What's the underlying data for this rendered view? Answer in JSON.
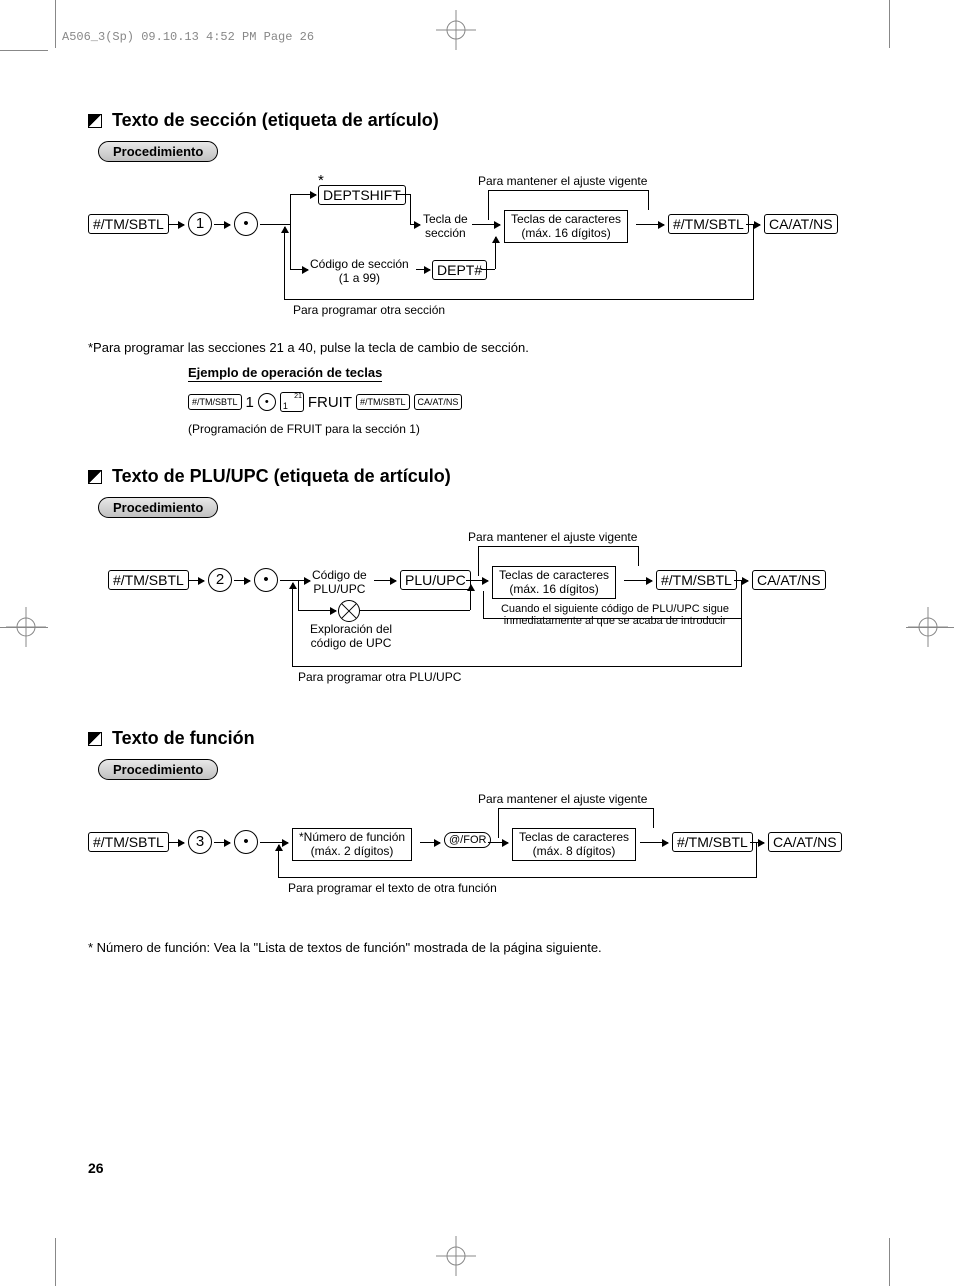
{
  "header": "A506_3(Sp)  09.10.13 4:52 PM  Page 26",
  "pageNumber": "26",
  "sec1": {
    "heading": "Texto de sección (etiqueta de artículo)",
    "proc": "Procedimiento",
    "preserve": "Para mantener el ajuste vigente",
    "k1": "#/TM/SBTL",
    "k2": "1",
    "k3": "•",
    "deptshift": "DEPTSHIFT",
    "asterisk": "*",
    "teclaDe": "Tecla de\nsección",
    "chars": "Teclas de caracteres\n(máx. 16 dígitos)",
    "k4": "#/TM/SBTL",
    "k5": "CA/AT/NS",
    "codSec": "Código de sección\n(1 a 99)",
    "dept": "DEPT#",
    "otraSec": "Para programar otra sección",
    "footnote": "*Para programar las secciones 21 a 40, pulse la tecla de cambio de sección.",
    "exTitle": "Ejemplo de operación de teclas",
    "ex_k1": "#/TM/SBTL",
    "ex_1": "1",
    "ex_dot": "•",
    "ex_sq_main": "1",
    "ex_sq_sup": "21",
    "ex_fruit": "FRUIT",
    "ex_k2": "#/TM/SBTL",
    "ex_k3": "CA/AT/NS",
    "exNote": "(Programación de FRUIT para la sección 1)"
  },
  "sec2": {
    "heading": "Texto de PLU/UPC (etiqueta de artículo)",
    "proc": "Procedimiento",
    "preserve": "Para mantener el ajuste vigente",
    "k1": "#/TM/SBTL",
    "k2": "2",
    "k3": "•",
    "codPlu": "Código de\nPLU/UPC",
    "pluupc": "PLU/UPC",
    "chars": "Teclas de caracteres\n(máx. 16 dígitos)",
    "k4": "#/TM/SBTL",
    "k5": "CA/AT/NS",
    "scan": "Exploración del\ncódigo de UPC",
    "cuando": "Cuando el siguiente código de PLU/UPC sigue\ninmediatamente al que se acaba de introducir",
    "otra": "Para programar otra PLU/UPC"
  },
  "sec3": {
    "heading": "Texto de función",
    "proc": "Procedimiento",
    "preserve": "Para mantener el ajuste vigente",
    "k1": "#/TM/SBTL",
    "k2": "3",
    "k3": "•",
    "numFunc": "*Número de función\n(máx. 2 dígitos)",
    "atfor": "@/FOR",
    "chars": "Teclas de caracteres\n(máx. 8 dígitos)",
    "k4": "#/TM/SBTL",
    "k5": "CA/AT/NS",
    "otra": "Para programar el texto de otra función",
    "footnote": "* Número de función: Vea la \"Lista de textos de función\" mostrada de la página siguiente."
  }
}
